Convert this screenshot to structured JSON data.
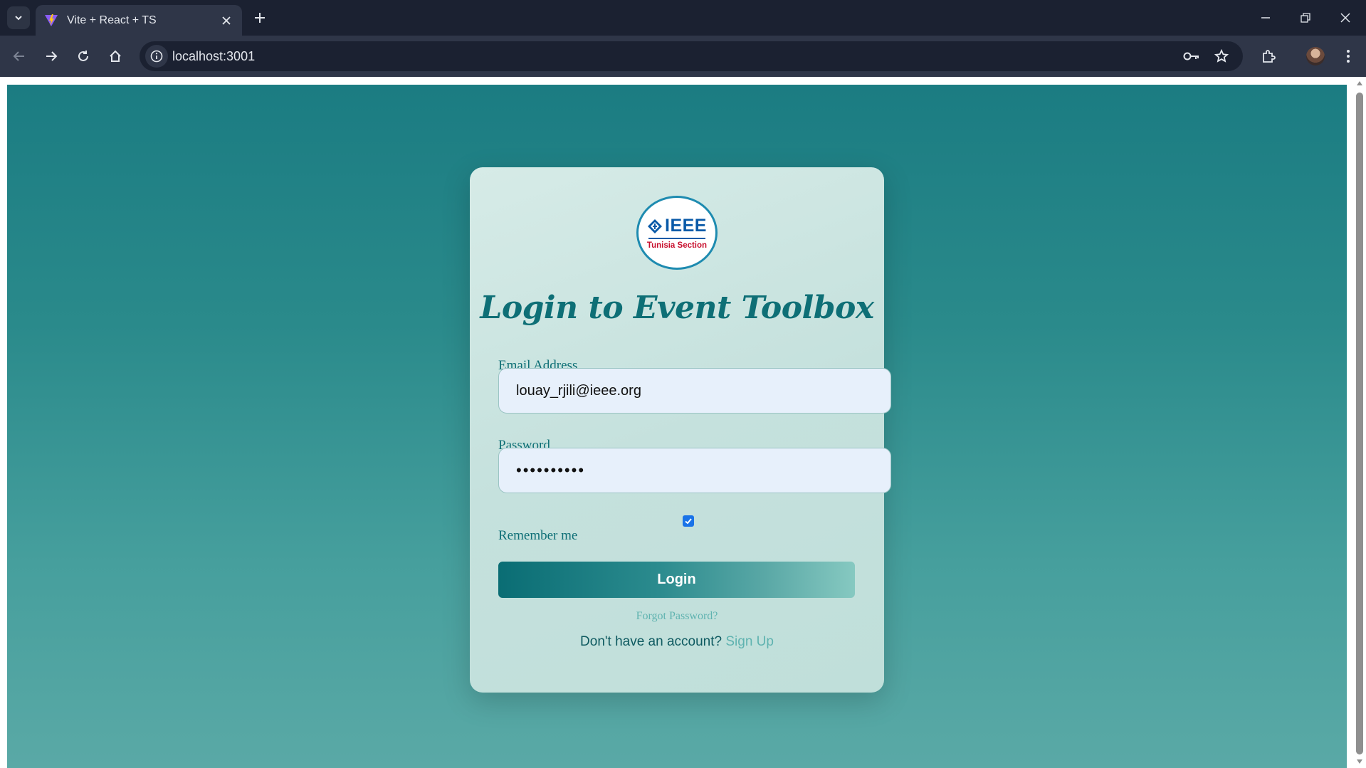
{
  "browser": {
    "tab_title": "Vite + React + TS",
    "url": "localhost:3001"
  },
  "login": {
    "logo_main": "IEEE",
    "logo_sub": "Tunisia Section",
    "title": "Login to Event Toolbox",
    "email_label": "Email Address",
    "email_value": "louay_rjili@ieee.org",
    "password_label": "Password",
    "password_value": "••••••••••",
    "remember_label": "Remember me",
    "remember_checked": true,
    "login_button": "Login",
    "forgot_link": "Forgot Password?",
    "signup_prompt": "Don't have an account?",
    "signup_link": "Sign Up"
  },
  "colors": {
    "accent": "#0e6f76",
    "link": "#5fb3b0",
    "checkbox": "#1a73e8"
  }
}
